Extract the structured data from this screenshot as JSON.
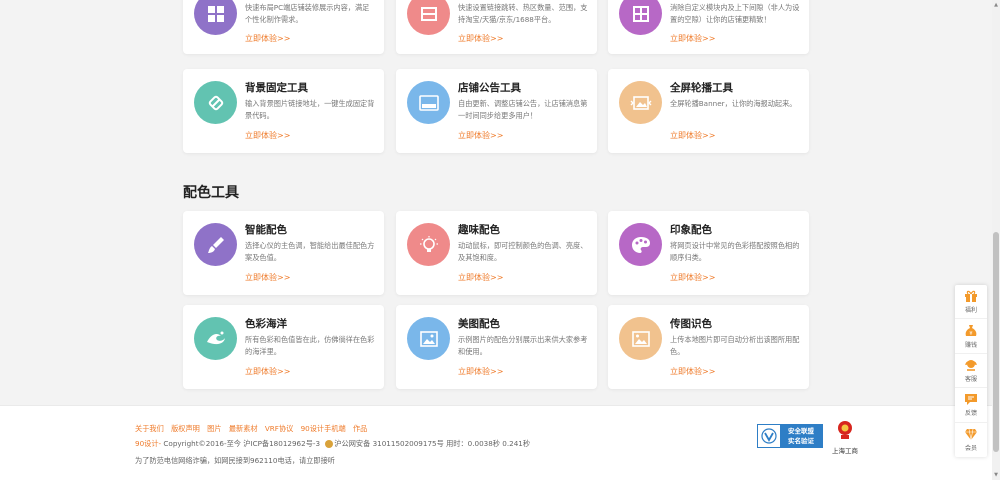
{
  "top_cards": [
    {
      "desc": "快速布局PC端店铺装修展示内容，满足个性化制作需求。",
      "link": "立即体验>>",
      "color": "#8f72c8",
      "icon": "grid-layout-icon"
    },
    {
      "desc": "快速设置链接跳转、热区数量、范围，支持淘宝/天猫/京东/1688平台。",
      "link": "立即体验>>",
      "color": "#ef8a8a",
      "icon": "hotspot-icon"
    },
    {
      "desc": "消除自定义模块内及上下间隙（非人为设置的空隙）让你的店铺更精致！",
      "link": "立即体验>>",
      "color": "#b768c6",
      "icon": "gap-removal-icon"
    }
  ],
  "tool_cards": [
    {
      "title": "背景固定工具",
      "desc": "输入背景图片链接地址，一键生成固定背景代码。",
      "link": "立即体验>>",
      "color": "#62c3b1",
      "icon": "link-icon"
    },
    {
      "title": "店铺公告工具",
      "desc": "自由更新、调整店铺公告，让店铺消息第一时间同步给更多用户！",
      "link": "立即体验>>",
      "color": "#7ab7ea",
      "icon": "notice-board-icon"
    },
    {
      "title": "全屏轮播工具",
      "desc": "全屏轮播Banner，让你的海报动起来。",
      "link": "立即体验>>",
      "color": "#f1c28e",
      "icon": "carousel-icon"
    }
  ],
  "section_title": "配色工具",
  "color_cards": [
    {
      "title": "智能配色",
      "desc": "选择心仪的主色调，智能给出最佳配色方案及色值。",
      "link": "立即体验>>",
      "color": "#8f72c8",
      "icon": "paint-brush-icon"
    },
    {
      "title": "趣味配色",
      "desc": "动动鼠标，即可控制颜色的色调、亮度、及其饱和度。",
      "link": "立即体验>>",
      "color": "#ef8a8a",
      "icon": "light-bulb-icon"
    },
    {
      "title": "印象配色",
      "desc": "将网页设计中常见的色彩搭配按照色相的顺序归类。",
      "link": "立即体验>>",
      "color": "#b768c6",
      "icon": "palette-icon"
    },
    {
      "title": "色彩海洋",
      "desc": "所有色彩和色值皆在此，仿佛徜徉在色彩的海洋里。",
      "link": "立即体验>>",
      "color": "#62c3b1",
      "icon": "wave-icon"
    },
    {
      "title": "美图配色",
      "desc": "示例图片的配色分别展示出来供大家参考和使用。",
      "link": "立即体验>>",
      "color": "#7ab7ea",
      "icon": "image-icon"
    },
    {
      "title": "传图识色",
      "desc": "上传本地图片即可自动分析出该图所用配色。",
      "link": "立即体验>>",
      "color": "#f1c28e",
      "icon": "upload-image-icon"
    }
  ],
  "footer": {
    "links": [
      "关于我们",
      "版权声明",
      "图片",
      "最新素材",
      "VRF协议",
      "90设计手机端",
      "作品"
    ],
    "copy_brand": "90设计-",
    "copy_text": " Copyright©2016-至今 沪ICP备18012962号-3",
    "police_text": "沪公网安备 31011502009175号 用时：0.0038秒 0.241秒",
    "notice": "为了防范电信网络诈骗，如网民接到962110电话，请立即接听",
    "badge_line1": "安全联盟",
    "badge_line2": "实名验证",
    "gov_label": "上海工商"
  },
  "sidebar": [
    {
      "label": "福利",
      "icon": "gift-icon",
      "color": "#f39a2b"
    },
    {
      "label": "赚钱",
      "icon": "money-bag-icon",
      "color": "#f39a2b"
    },
    {
      "label": "客服",
      "icon": "customer-service-icon",
      "color": "#f39a2b"
    },
    {
      "label": "反馈",
      "icon": "feedback-icon",
      "color": "#f39a2b"
    },
    {
      "label": "会员",
      "icon": "diamond-icon",
      "color": "#f39a2b"
    }
  ]
}
